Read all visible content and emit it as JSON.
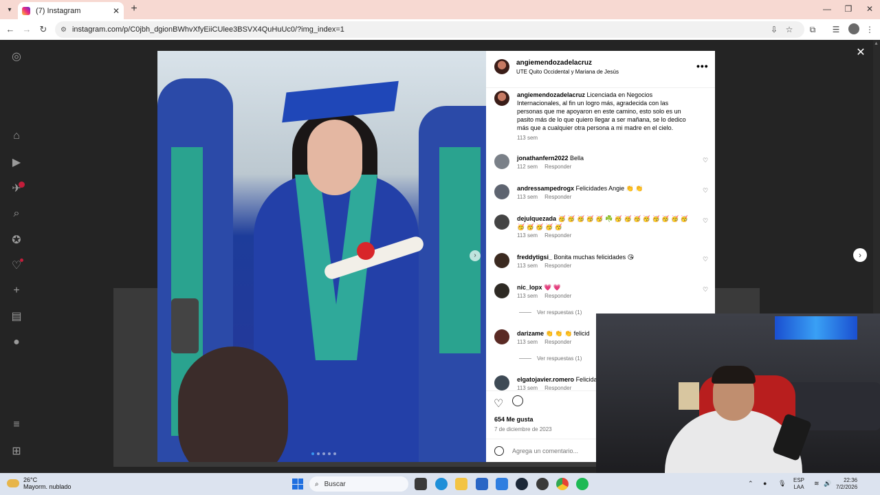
{
  "browser": {
    "tab_title": "(7) Instagram",
    "new_tab_label": "+",
    "url": "instagram.com/p/C0jbh_dgionBWhvXfyEiiCUlee3BSVX4QuHuUc0/?img_index=1"
  },
  "post": {
    "username": "angiemendozadelacruz",
    "location": "UTE Quito Occidental y Mariana de Jesús",
    "caption": "Licenciada en Negocios Internacionales, al fin un logro más, agradecida con las personas que me apoyaron en este camino, esto solo es un pasito más de lo que quiero llegar a ser mañana, se lo dedico más que a cualquier otra persona a mi madre en el cielo.",
    "caption_time": "113 sem",
    "likes": "654 Me gusta",
    "date": "7 de diciembre de 2023",
    "comment_placeholder": "Agrega un comentario...",
    "comments": [
      {
        "user": "jonathanfern2022",
        "text": "Bella",
        "time": "112 sem",
        "reply": "Responder"
      },
      {
        "user": "andressampedrogx",
        "text": "Felicidades Angie 👏 👏",
        "time": "113 sem",
        "reply": "Responder"
      },
      {
        "user": "dejulquezada",
        "text": "🥳 🥳 🥳 🥳 🥳 ☘️ 🥳 🥳 🥳 🥳 🥳 🥳 🥳 🥳 🥳 🥳 🥳 🥳 🥳",
        "time": "113 sem",
        "reply": "Responder"
      },
      {
        "user": "freddytigsi_",
        "text": "Bonita muchas felicidades 😘",
        "time": "113 sem",
        "reply": "Responder"
      },
      {
        "user": "nic_lopx",
        "text": "💗 💗",
        "time": "113 sem",
        "reply": "Responder",
        "replies": "Ver respuestas (1)"
      },
      {
        "user": "darizame",
        "text": "👏 👏 👏 felicid",
        "time": "113 sem",
        "reply": "Responder",
        "replies": "Ver respuestas (1)"
      },
      {
        "user": "elgatojavier.romero",
        "text": "Felicida",
        "time": "113 sem",
        "reply": "Responder"
      }
    ]
  },
  "taskbar": {
    "temp": "26°C",
    "condition": "Mayorm. nublado",
    "search_label": "Buscar",
    "lang_top": "ESP",
    "lang_bottom": "LAA",
    "time": "22:36",
    "date": "7/2/2026"
  }
}
